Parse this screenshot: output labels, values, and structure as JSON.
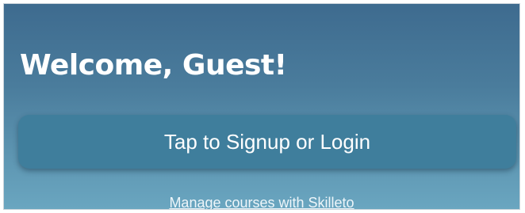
{
  "welcome": {
    "title": "Welcome, Guest!"
  },
  "auth": {
    "signup_button_label": "Tap to Signup or Login"
  },
  "footer": {
    "manage_link_text": "Manage courses with Skilleto"
  },
  "colors": {
    "background_top": "#3e6b8f",
    "background_bottom": "#6aa6c0",
    "button_background": "#3f7e9c",
    "text": "#ffffff"
  }
}
